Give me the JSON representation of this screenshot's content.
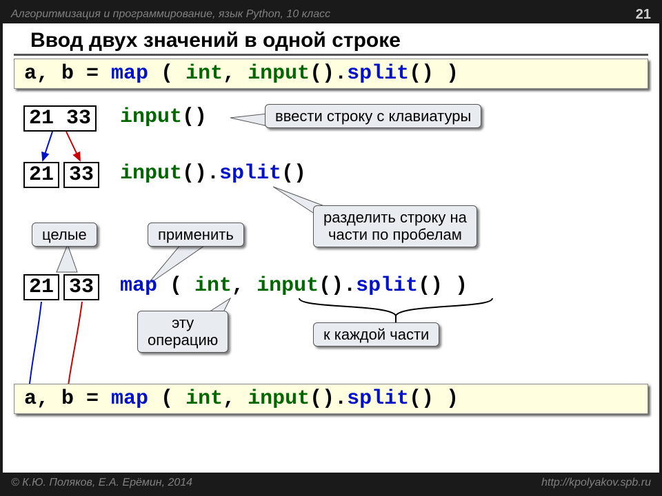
{
  "header": {
    "subject": "Алгоритмизация и программирование, язык Python, 10 класс",
    "page": "21"
  },
  "title": "Ввод двух значений в одной строке",
  "code_top": {
    "prefix": "a, b = ",
    "map": "map",
    "paren_open": " ( ",
    "int": "int",
    "comma": ", ",
    "input": "input",
    "call": "().",
    "split": "split",
    "tail": "() )"
  },
  "row1": {
    "val": "21 33",
    "code_input": "input",
    "code_tail": "()"
  },
  "row2": {
    "v1": "21",
    "v2": "33",
    "code_input": "input",
    "mid": "().",
    "split": "split",
    "tail": "()"
  },
  "row3": {
    "v1": "21",
    "v2": "33",
    "map": "map",
    "open": " ( ",
    "int": "int",
    "comma": ", ",
    "input": "input",
    "mid": "().",
    "split": "split",
    "tail": "() )"
  },
  "callouts": {
    "c1": "ввести строку с клавиатуры",
    "c2": "разделить строку на\nчасти по пробелам",
    "c3": "целые",
    "c4": "применить",
    "c5": "эту\nоперацию",
    "c6": "к каждой части"
  },
  "code_bottom": {
    "prefix": "a, b = ",
    "map": "map",
    "paren_open": " ( ",
    "int": "int",
    "comma": ", ",
    "input": "input",
    "call": "().",
    "split": "split",
    "tail": "() )"
  },
  "footer": {
    "left": "© К.Ю. Поляков, Е.А. Ерёмин, 2014",
    "right": "http://kpolyakov.spb.ru"
  }
}
